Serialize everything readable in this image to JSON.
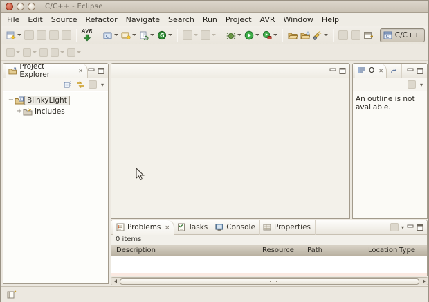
{
  "window": {
    "title": "C/C++  -  Eclipse"
  },
  "menu_bar": {
    "items": [
      "File",
      "Edit",
      "Source",
      "Refactor",
      "Navigate",
      "Search",
      "Run",
      "Project",
      "AVR",
      "Window",
      "Help"
    ]
  },
  "toolbar": {
    "avr_label": "AVR",
    "g_label": "G",
    "perspective_label": "C/C++"
  },
  "glyphs": {
    "close_tab": "✕",
    "view_menu": "▾",
    "collapse_minus": "−",
    "expand_plus": "+"
  },
  "project_explorer": {
    "title": "Project Explorer",
    "tree": [
      {
        "label": "BlinkyLight",
        "state": "expanded",
        "selected": true
      },
      {
        "label": "Includes",
        "state": "collapsed",
        "selected": false
      }
    ]
  },
  "outline": {
    "tab_label": "O",
    "message": "An outline is not available."
  },
  "problems_view": {
    "tabs": [
      "Problems",
      "Tasks",
      "Console",
      "Properties"
    ],
    "active_tab": "Problems",
    "items_count_label": "0 items",
    "columns": [
      "Description",
      "Resource",
      "Path",
      "Location",
      "Type"
    ]
  },
  "colors": {
    "window_bg": "#ece8e0",
    "titlebar_top": "#ddd7cd",
    "titlebar_bottom": "#c9c1b3",
    "close_button": "#c0472c",
    "panel_border": "#a39b8c",
    "table_header": "#c3bbab",
    "empty_table_highlight": "#fbe9e1",
    "run_green": "#3fae49",
    "avr_arrow_green": "#2f8f35"
  }
}
